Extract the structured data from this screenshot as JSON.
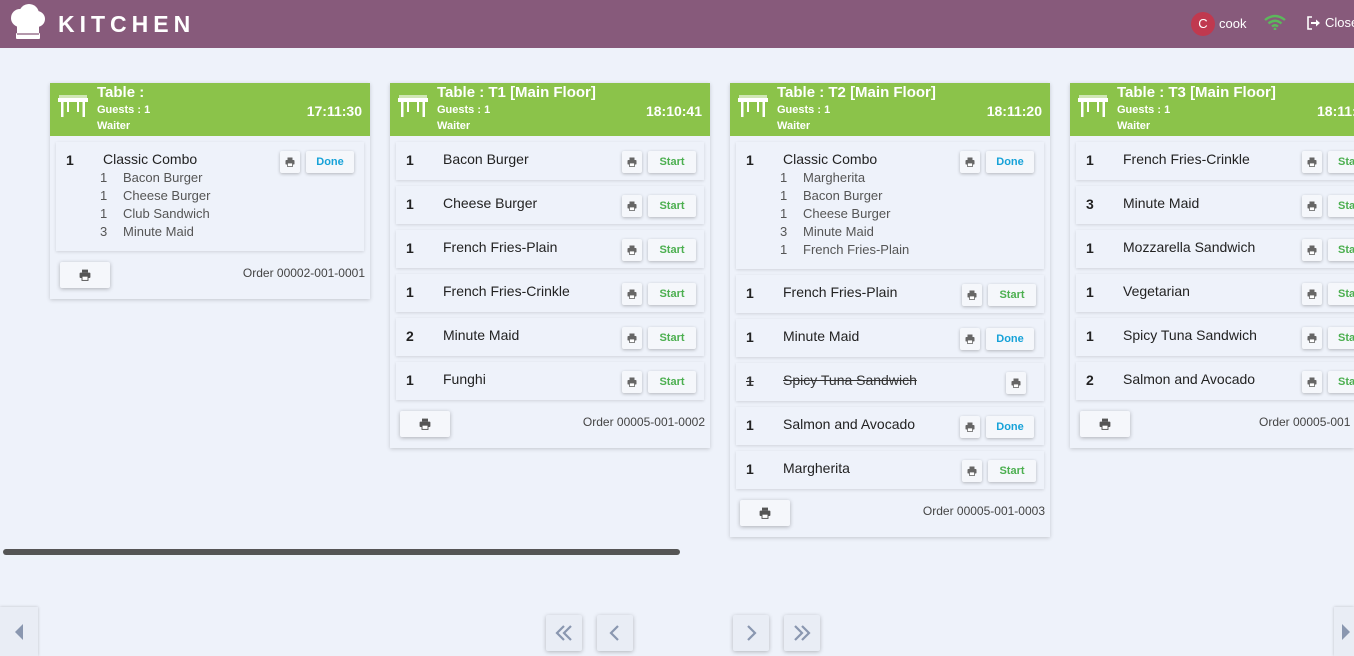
{
  "app": {
    "title": "KITCHEN"
  },
  "user": {
    "initial": "C",
    "name": "cook"
  },
  "header": {
    "close_label": "Close"
  },
  "icons": {
    "logo": "chef-hat-icon",
    "wifi": "wifi-icon",
    "close": "sign-out-icon",
    "table": "table-icon",
    "print": "print-icon"
  },
  "colors": {
    "topbar": "#875a7b",
    "card_header": "#8bc34a",
    "start": "#4caf50",
    "done": "#17a2d8",
    "wifi": "#5cb85c",
    "avatar": "#c0394f"
  },
  "orders": [
    {
      "table": "Table :",
      "guests": "Guests : 1",
      "waiter": "Waiter",
      "time": "17:11:30",
      "order_ref": "Order 00002-001-0001",
      "lines": [
        {
          "qty": "1",
          "name": "Classic Combo",
          "action": "Done",
          "status": "done",
          "subs": [
            {
              "qty": "1",
              "name": "Bacon Burger"
            },
            {
              "qty": "1",
              "name": "Cheese Burger"
            },
            {
              "qty": "1",
              "name": "Club Sandwich"
            },
            {
              "qty": "3",
              "name": "Minute Maid"
            }
          ]
        }
      ]
    },
    {
      "table": "Table : T1  [Main Floor]",
      "guests": "Guests : 1",
      "waiter": "Waiter",
      "time": "18:10:41",
      "order_ref": "Order 00005-001-0002",
      "lines": [
        {
          "qty": "1",
          "name": "Bacon Burger",
          "action": "Start",
          "status": "start"
        },
        {
          "qty": "1",
          "name": "Cheese Burger",
          "action": "Start",
          "status": "start"
        },
        {
          "qty": "1",
          "name": "French Fries-Plain",
          "action": "Start",
          "status": "start"
        },
        {
          "qty": "1",
          "name": "French Fries-Crinkle",
          "action": "Start",
          "status": "start"
        },
        {
          "qty": "2",
          "name": "Minute Maid",
          "action": "Start",
          "status": "start"
        },
        {
          "qty": "1",
          "name": "Funghi",
          "action": "Start",
          "status": "start"
        }
      ]
    },
    {
      "table": "Table : T2  [Main Floor]",
      "guests": "Guests : 1",
      "waiter": "Waiter",
      "time": "18:11:20",
      "order_ref": "Order 00005-001-0003",
      "lines": [
        {
          "qty": "1",
          "name": "Classic Combo",
          "action": "Done",
          "status": "done",
          "subs": [
            {
              "qty": "1",
              "name": "Margherita"
            },
            {
              "qty": "1",
              "name": "Bacon Burger"
            },
            {
              "qty": "1",
              "name": "Cheese Burger"
            },
            {
              "qty": "3",
              "name": "Minute Maid"
            },
            {
              "qty": "1",
              "name": "French Fries-Plain"
            }
          ]
        },
        {
          "qty": "1",
          "name": "French Fries-Plain",
          "action": "Start",
          "status": "start"
        },
        {
          "qty": "1",
          "name": "Minute Maid",
          "action": "Done",
          "status": "done"
        },
        {
          "qty": "1",
          "name": "Spicy Tuna Sandwich",
          "action": "",
          "status": "cancelled"
        },
        {
          "qty": "1",
          "name": "Salmon and Avocado",
          "action": "Done",
          "status": "done"
        },
        {
          "qty": "1",
          "name": "Margherita",
          "action": "Start",
          "status": "start"
        }
      ]
    },
    {
      "table": "Table : T3  [Main Floor]",
      "guests": "Guests : 1",
      "waiter": "Waiter",
      "time": "18:11:",
      "order_ref": "Order 00005-001",
      "lines": [
        {
          "qty": "1",
          "name": "French Fries-Crinkle",
          "action": "Sta",
          "status": "start"
        },
        {
          "qty": "3",
          "name": "Minute Maid",
          "action": "Sta",
          "status": "start"
        },
        {
          "qty": "1",
          "name": "Mozzarella Sandwich",
          "action": "Sta",
          "status": "start"
        },
        {
          "qty": "1",
          "name": "Vegetarian",
          "action": "Sta",
          "status": "start"
        },
        {
          "qty": "1",
          "name": "Spicy Tuna Sandwich",
          "action": "Sta",
          "status": "start"
        },
        {
          "qty": "2",
          "name": "Salmon and Avocado",
          "action": "Sta",
          "status": "start"
        }
      ]
    }
  ],
  "navigation": {
    "edge_left": "triangle-left-icon",
    "edge_right": "triangle-right-icon",
    "first": "double-chevron-left-icon",
    "prev": "chevron-left-icon",
    "next": "chevron-right-icon",
    "last": "double-chevron-right-icon"
  }
}
